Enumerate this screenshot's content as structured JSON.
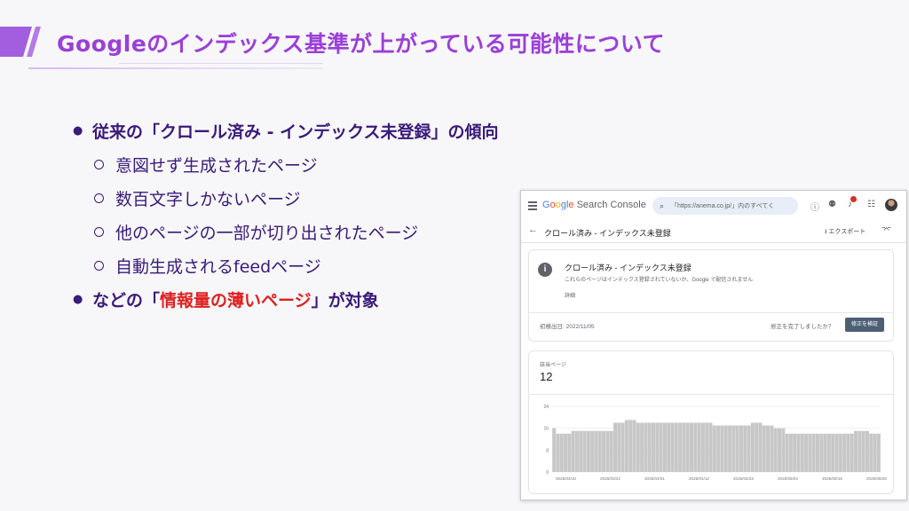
{
  "slide": {
    "title": "Googleのインデックス基準が上がっている可能性について",
    "accent_color": "#9b3fd8",
    "bullets": {
      "b1": "従来の「クロール済み - インデックス未登録」の傾向",
      "b1_subs": [
        "意図せず生成されたページ",
        "数百文字しかないページ",
        "他のページの一部が切り出されたページ",
        "自動生成されるfeedページ"
      ],
      "b2_pre": "などの「",
      "b2_highlight": "情報量の薄いページ",
      "b2_post": "」が対象",
      "highlight_color": "#e02020"
    }
  },
  "gsc": {
    "logo": {
      "g": "G",
      "o1": "o",
      "o2": "o",
      "g2": "g",
      "l": "l",
      "e": "e",
      "rest": " Search Console"
    },
    "search_placeholder": "「https://anema.co.jp/」内のすべてく",
    "icons": [
      "menu-icon",
      "search-icon",
      "help-icon",
      "people-icon",
      "bell-icon",
      "apps-icon",
      "avatar"
    ],
    "notification_count": "1",
    "page_title": "クロール済み - インデックス未登録",
    "export_label": "エクスポート",
    "status_card": {
      "title": "クロール済み - インデックス未登録",
      "description": "これらのページはインデックス登録されていないか、Google で配信されません",
      "details_link": "詳細",
      "first_detected": "初検出日: 2022/11/05",
      "fix_question": "修正を完了しましたか？",
      "validate_button": "修正を検証"
    },
    "pages_card": {
      "label": "該当ページ",
      "value": "12"
    }
  },
  "chart_data": {
    "type": "bar",
    "title": "",
    "xlabel": "",
    "ylabel": "",
    "ylim": [
      0,
      24
    ],
    "y_ticks": [
      0,
      8,
      16,
      24
    ],
    "x_tick_labels": [
      "2025/03/10",
      "2025/03/21",
      "2025/04/01",
      "2025/04/12",
      "2025/04/23",
      "2025/05/04",
      "2025/05/15",
      "2025/05/26"
    ],
    "bar_color": "#c7c7c7",
    "values": [
      16,
      14,
      14,
      14,
      14,
      15,
      15,
      15,
      15,
      15,
      15,
      15,
      15,
      15,
      15,
      15,
      18,
      18,
      18,
      19,
      19,
      19,
      18,
      18,
      18,
      18,
      18,
      18,
      18,
      18,
      18,
      18,
      18,
      18,
      18,
      18,
      18,
      18,
      18,
      18,
      18,
      18,
      17,
      17,
      17,
      17,
      17,
      17,
      17,
      17,
      17,
      17,
      18,
      18,
      18,
      17,
      17,
      17,
      16,
      16,
      16,
      14,
      14,
      14,
      14,
      14,
      14,
      14,
      14,
      14,
      14,
      14,
      14,
      14,
      14,
      14,
      14,
      14,
      14,
      15,
      15,
      15,
      15,
      14,
      14,
      14
    ]
  }
}
